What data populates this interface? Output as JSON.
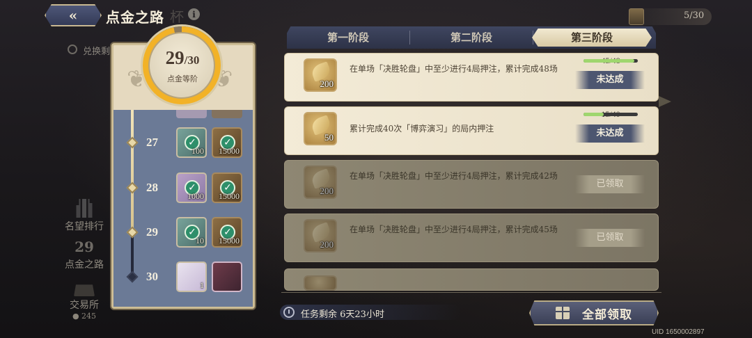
{
  "header": {
    "back_arrow": "«",
    "title": "点金之路",
    "title_shadow": "杯",
    "info_icon": "i",
    "ticket_count": "5/30"
  },
  "exchange_label": "兑换剩",
  "side_nav": {
    "items": [
      {
        "label": "名望排行",
        "icon": "rank-icon"
      },
      {
        "label": "点金之路",
        "icon": "road-icon",
        "number": "29"
      },
      {
        "label": "交易所",
        "icon": "shop-icon",
        "coin": "245"
      }
    ]
  },
  "rank_panel": {
    "current": "29",
    "total": "30",
    "label": "点金等阶",
    "progress_fraction": 0.967,
    "levels": [
      {
        "level": "27",
        "rewards": [
          {
            "qty": "100",
            "claimed": true,
            "style": "teal"
          },
          {
            "qty": "15000",
            "claimed": true,
            "style": "gold"
          }
        ]
      },
      {
        "level": "28",
        "rewards": [
          {
            "qty": "1000",
            "claimed": true,
            "style": "purple"
          },
          {
            "qty": "15000",
            "claimed": true,
            "style": "gold"
          }
        ]
      },
      {
        "level": "29",
        "rewards": [
          {
            "qty": "10",
            "claimed": true,
            "style": "teal"
          },
          {
            "qty": "15000",
            "claimed": true,
            "style": "gold"
          }
        ]
      },
      {
        "level": "30",
        "rewards": [
          {
            "qty": "1",
            "claimed": false,
            "style": "pearl"
          },
          {
            "qty": "",
            "claimed": false,
            "style": "poster"
          }
        ]
      }
    ]
  },
  "tabs": [
    {
      "label": "第一阶段",
      "active": false
    },
    {
      "label": "第二阶段",
      "active": false
    },
    {
      "label": "第三阶段",
      "active": true
    }
  ],
  "quests": [
    {
      "reward_qty": "200",
      "desc": "在单场「决胜轮盘」中至少进行4局押注，累计完成48场",
      "progress_text": "45/48",
      "progress": 0.9375,
      "status": "未达成",
      "claimed": false
    },
    {
      "reward_qty": "50",
      "desc": "累计完成40次「博弈演习」的局内押注",
      "progress_text": "15/40",
      "progress": 0.375,
      "status": "未达成",
      "claimed": false
    },
    {
      "reward_qty": "200",
      "desc": "在单场「决胜轮盘」中至少进行4局押注，累计完成42场",
      "status": "已领取",
      "claimed": true
    },
    {
      "reward_qty": "200",
      "desc": "在单场「决胜轮盘」中至少进行4局押注，累计完成45场",
      "status": "已领取",
      "claimed": true
    }
  ],
  "footer": {
    "timer": "任务剩余 6天23小时",
    "claim_all": "全部领取",
    "uid": "UID 1650002897"
  },
  "colors": {
    "accent_gold": "#f2b227",
    "panel_blue": "#6b7a96",
    "progress_green": "#9fd66e"
  }
}
